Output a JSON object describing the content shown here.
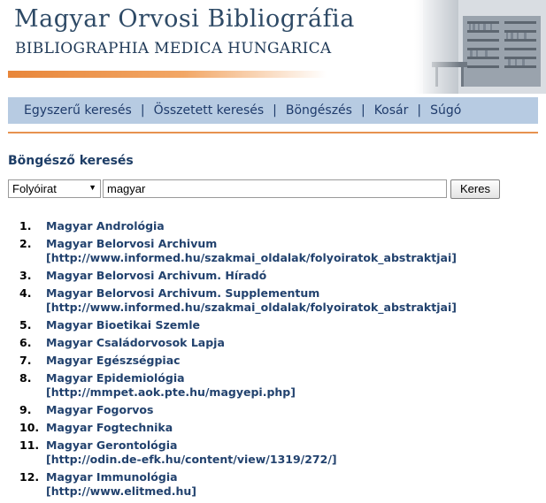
{
  "header": {
    "title": "Magyar Orvosi Bibliográfia",
    "subtitle": "BIBLIOGRAPHIA MEDICA HUNGARICA"
  },
  "nav": {
    "items": [
      "Egyszerű keresés",
      "Összetett keresés",
      "Böngészés",
      "Kosár",
      "Súgó"
    ],
    "separator": "|"
  },
  "page": {
    "title": "Böngésző keresés"
  },
  "search": {
    "type_value": "Folyóirat",
    "query": "magyar",
    "button_label": "Keres"
  },
  "results": [
    {
      "num": "1.",
      "title": "Magyar Andrológia",
      "url": ""
    },
    {
      "num": "2.",
      "title": "Magyar Belorvosi Archivum",
      "url": "[http://www.informed.hu/szakmai_oldalak/folyoiratok_abstraktjai]"
    },
    {
      "num": "3.",
      "title": "Magyar Belorvosi Archivum. Híradó",
      "url": ""
    },
    {
      "num": "4.",
      "title": "Magyar Belorvosi Archivum. Supplementum",
      "url": "[http://www.informed.hu/szakmai_oldalak/folyoiratok_abstraktjai]"
    },
    {
      "num": "5.",
      "title": "Magyar Bioetikai Szemle",
      "url": ""
    },
    {
      "num": "6.",
      "title": "Magyar Családorvosok Lapja",
      "url": ""
    },
    {
      "num": "7.",
      "title": "Magyar Egészségpiac",
      "url": ""
    },
    {
      "num": "8.",
      "title": "Magyar Epidemiológia",
      "url": "[http://mmpet.aok.pte.hu/magyepi.php]"
    },
    {
      "num": "9.",
      "title": "Magyar Fogorvos",
      "url": ""
    },
    {
      "num": "10.",
      "title": "Magyar Fogtechnika",
      "url": ""
    },
    {
      "num": "11.",
      "title": "Magyar Gerontológia",
      "url": "[http://odin.de-efk.hu/content/view/1319/272/]"
    },
    {
      "num": "12.",
      "title": "Magyar Immunológia",
      "url": "[http://www.elitmed.hu]"
    }
  ],
  "colors": {
    "accent_orange": "#e8863a",
    "nav_background": "#b7cbe2",
    "link": "#22426e"
  }
}
